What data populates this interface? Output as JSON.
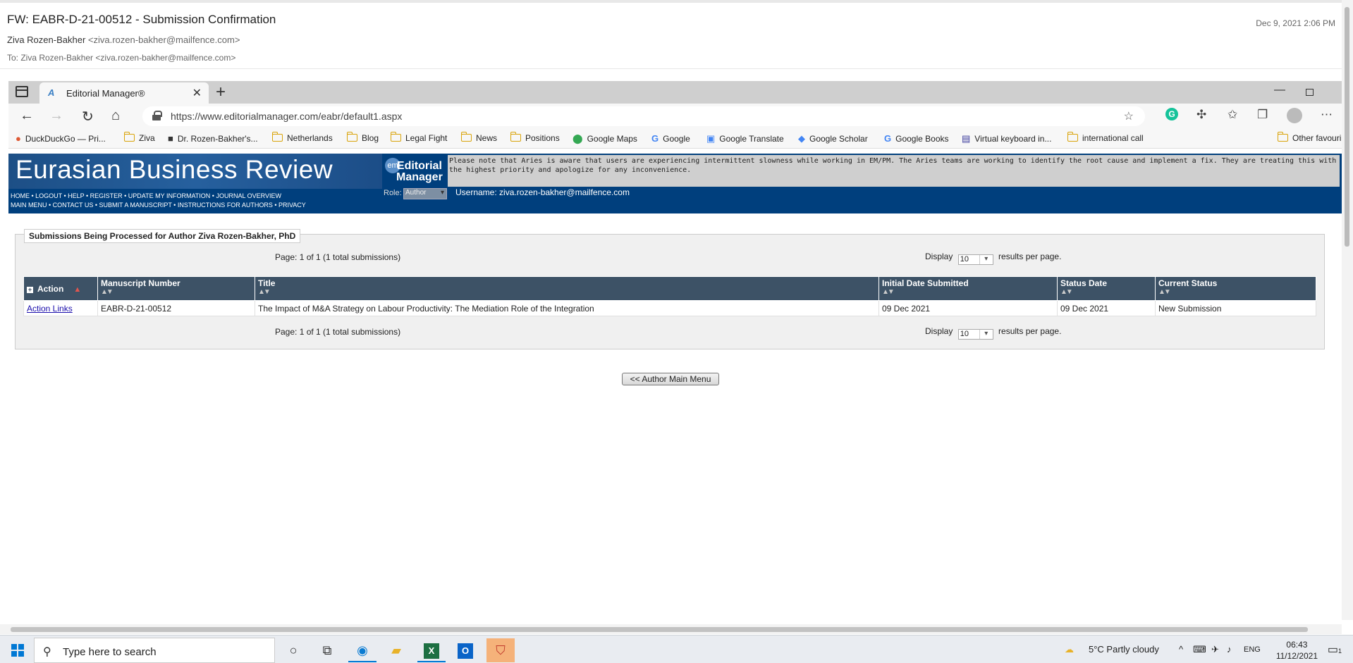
{
  "email": {
    "subject": "FW: EABR-D-21-00512 - Submission Confirmation",
    "from_name": "Ziva Rozen-Bakher",
    "from_addr": "<ziva.rozen-bakher@mailfence.com>",
    "to_label": "To: Ziva Rozen-Bakher",
    "to_addr": "<ziva.rozen-bakher@mailfence.com>",
    "date": "Dec 9, 2021 2:06 PM"
  },
  "browser": {
    "tab_title": "Editorial Manager®",
    "tab_favicon": "A",
    "url": "https://www.editorialmanager.com/eabr/default1.aspx",
    "bookmarks": [
      "DuckDuckGo — Pri...",
      "Ziva",
      "Dr. Rozen-Bakher's...",
      "Netherlands",
      "Blog",
      "Legal Fight",
      "News",
      "Positions",
      "Google Maps",
      "Google",
      "Google Translate",
      "Google Scholar",
      "Google Books",
      "Virtual keyboard in...",
      "international call",
      "Other favouri"
    ]
  },
  "em": {
    "journal_title": "Eurasian Business Review",
    "logo_badge": "em",
    "logo_line1": "Editorial",
    "logo_line2": "Manager",
    "links_line1": "HOME  •  LOGOUT  •  HELP  •  REGISTER  •  UPDATE MY INFORMATION  •  JOURNAL OVERVIEW",
    "links_line2": "MAIN MENU  •  CONTACT US  •  SUBMIT A MANUSCRIPT  •  INSTRUCTIONS FOR AUTHORS  •  PRIVACY",
    "notice": "Please note that Aries is aware that users are experiencing intermittent slowness while working in EM/PM. The Aries teams are working to identify the root cause and implement a fix. They are treating this with the highest priority and apologize for any inconvenience.",
    "role_label": "Role:",
    "role_value": "Author",
    "username": "Username: ziva.rozen-bakher@mailfence.com"
  },
  "submissions": {
    "legend": "Submissions Being Processed for Author Ziva Rozen-Bakher, PhD",
    "page_info": "Page: 1 of 1 (1 total submissions)",
    "display_label": "Display",
    "display_value": "10",
    "display_suffix": "results per page.",
    "columns": [
      "Action",
      "Manuscript Number",
      "Title",
      "Initial Date Submitted",
      "Status Date",
      "Current Status"
    ],
    "sort_glyph": "▲▼",
    "rows": [
      {
        "action": "Action Links",
        "manuscript": "EABR-D-21-00512",
        "title": "The Impact of M&A Strategy on Labour Productivity: The Mediation Role of the Integration",
        "initial_date": "09 Dec 2021",
        "status_date": "09 Dec 2021",
        "status": "New Submission"
      }
    ],
    "main_menu_button": "<< Author Main Menu"
  },
  "taskbar": {
    "search_placeholder": "Type here to search",
    "weather": "5°C  Partly cloudy",
    "language": "ENG",
    "time": "06:43",
    "date": "11/12/2021",
    "notification_count": "1"
  },
  "icons": {
    "back": "back-arrow-icon",
    "forward": "forward-arrow-icon",
    "refresh": "refresh-icon",
    "home": "home-icon"
  }
}
